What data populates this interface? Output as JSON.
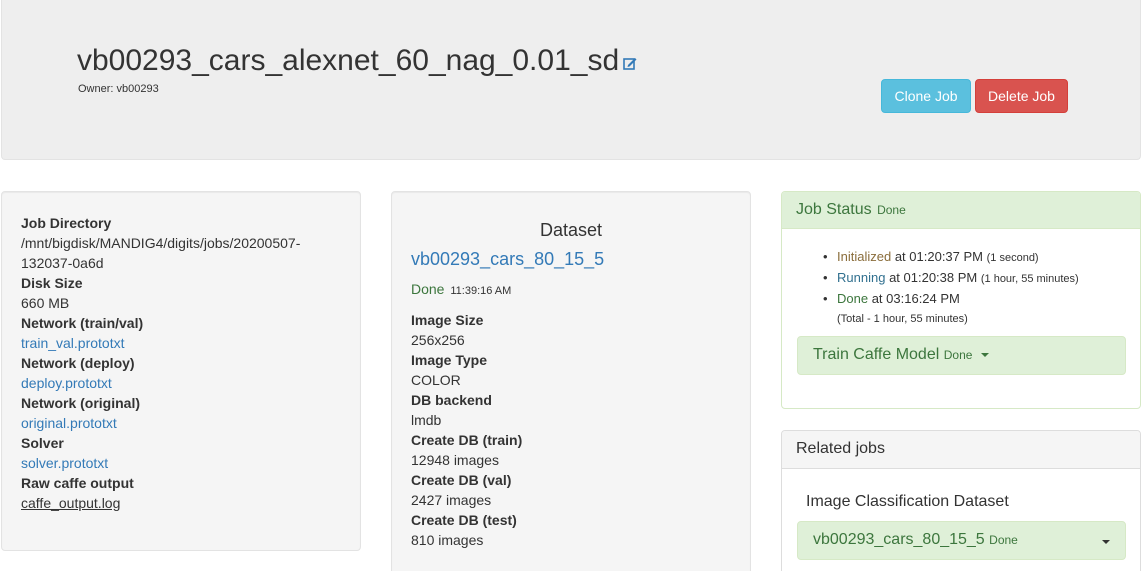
{
  "header": {
    "job_title": "vb00293_cars_alexnet_60_nag_0.01_sd",
    "owner_label": "Owner:",
    "owner_name": "vb00293",
    "clone_label": "Clone Job",
    "delete_label": "Delete Job"
  },
  "job_info": {
    "dir_label": "Job Directory",
    "dir_value": "/mnt/bigdisk/MANDIG4/digits/jobs/20200507-132037-0a6d",
    "disk_label": "Disk Size",
    "disk_value": "660 MB",
    "net_trainval_label": "Network (train/val)",
    "net_trainval_file": "train_val.prototxt",
    "net_deploy_label": "Network (deploy)",
    "net_deploy_file": "deploy.prototxt",
    "net_original_label": "Network (original)",
    "net_original_file": "original.prototxt",
    "solver_label": "Solver",
    "solver_file": "solver.prototxt",
    "raw_output_label": "Raw caffe output",
    "raw_output_file": "caffe_output.log"
  },
  "dataset": {
    "heading": "Dataset",
    "name": "vb00293_cars_80_15_5",
    "status": "Done",
    "status_time": "11:39:16 AM",
    "image_size_label": "Image Size",
    "image_size": "256x256",
    "image_type_label": "Image Type",
    "image_type": "COLOR",
    "db_backend_label": "DB backend",
    "db_backend": "lmdb",
    "create_train_label": "Create DB (train)",
    "create_train": "12948 images",
    "create_val_label": "Create DB (val)",
    "create_val": "2427 images",
    "create_test_label": "Create DB (test)",
    "create_test": "810 images"
  },
  "job_status": {
    "title": "Job Status",
    "state": "Done",
    "items": [
      {
        "state": "Initialized",
        "at": "at 01:20:37 PM",
        "duration": "(1 second)"
      },
      {
        "state": "Running",
        "at": "at 01:20:38 PM",
        "duration": "(1 hour, 55 minutes)"
      },
      {
        "state": "Done",
        "at": "at 03:16:24 PM",
        "duration": ""
      }
    ],
    "total": "(Total - 1 hour, 55 minutes)",
    "task_name": "Train Caffe Model",
    "task_state": "Done"
  },
  "related": {
    "title": "Related jobs",
    "type": "Image Classification Dataset",
    "job_name": "vb00293_cars_80_15_5",
    "job_state": "Done"
  },
  "colors": {
    "info_button": "#5bc0de",
    "danger_button": "#d9534f",
    "success_bg": "#dff0d8",
    "success_text": "#3c763d",
    "link": "#337ab7"
  }
}
